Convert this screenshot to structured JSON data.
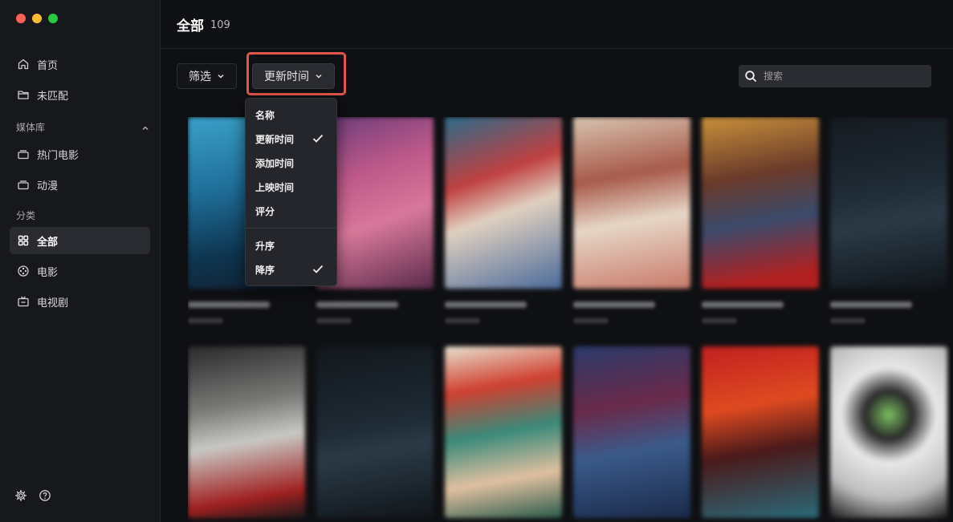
{
  "sidebar": {
    "items": [
      {
        "label": "首页",
        "icon": "home-icon"
      },
      {
        "label": "未匹配",
        "icon": "folder-icon"
      }
    ],
    "media_section": "媒体库",
    "media_items": [
      {
        "label": "热门电影",
        "icon": "library-icon"
      },
      {
        "label": "动漫",
        "icon": "library-icon"
      }
    ],
    "category_section": "分类",
    "category_items": [
      {
        "label": "全部",
        "icon": "grid-icon",
        "active": true
      },
      {
        "label": "电影",
        "icon": "film-reel-icon"
      },
      {
        "label": "电视剧",
        "icon": "tv-icon"
      }
    ]
  },
  "header": {
    "title": "全部",
    "count": "109"
  },
  "toolbar": {
    "filter_label": "筛选",
    "sort_label": "更新时间",
    "search_placeholder": "搜索"
  },
  "sort_menu": {
    "fields": [
      {
        "label": "名称",
        "checked": false
      },
      {
        "label": "更新时间",
        "checked": true
      },
      {
        "label": "添加时间",
        "checked": false
      },
      {
        "label": "上映时间",
        "checked": false
      },
      {
        "label": "评分",
        "checked": false
      }
    ],
    "orders": [
      {
        "label": "升序",
        "checked": false
      },
      {
        "label": "降序",
        "checked": true
      }
    ]
  },
  "colors": {
    "accent_highlight": "#e2564a",
    "sidebar_bg": "#17181c",
    "main_bg": "#0f1013",
    "menu_bg": "#25262b"
  }
}
